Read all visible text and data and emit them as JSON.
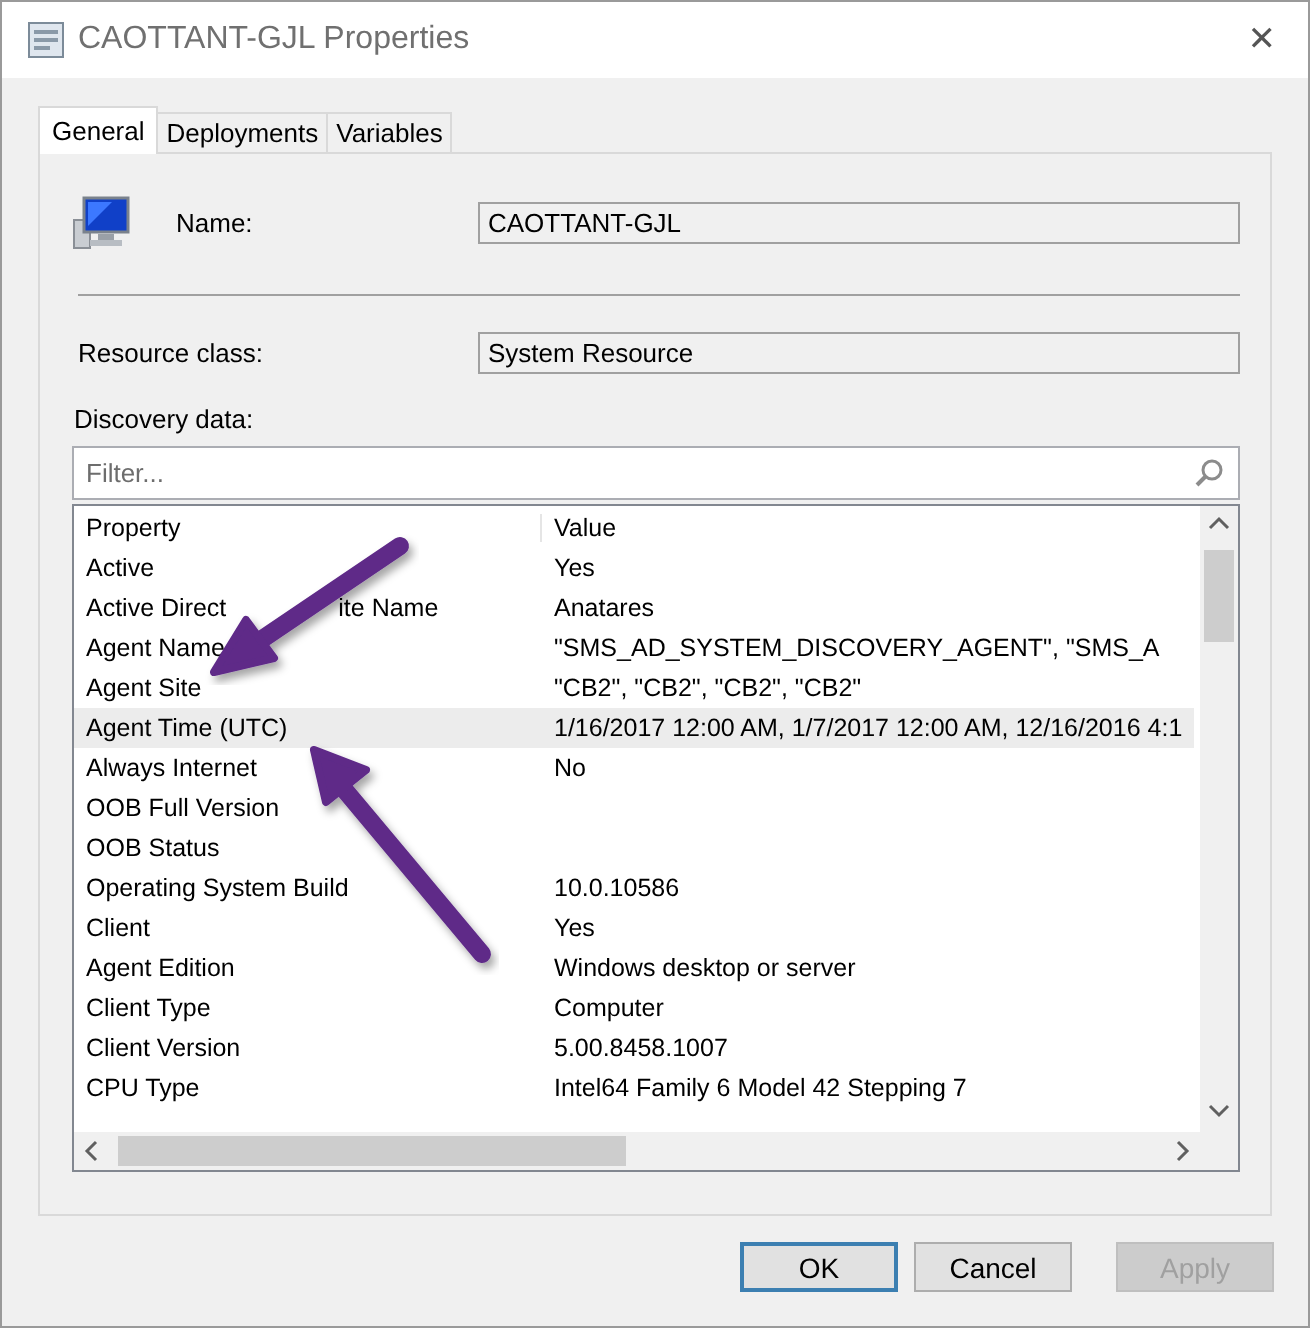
{
  "window": {
    "title": "CAOTTANT-GJL Properties",
    "close": "✕"
  },
  "tabs": [
    {
      "label": "General",
      "selected": true
    },
    {
      "label": "Deployments",
      "selected": false
    },
    {
      "label": "Variables",
      "selected": false
    }
  ],
  "general": {
    "name_label": "Name:",
    "name_value": "CAOTTANT-GJL",
    "class_label": "Resource class:",
    "class_value": "System Resource",
    "discovery_label": "Discovery data:"
  },
  "filter": {
    "placeholder": "Filter..."
  },
  "table": {
    "columns": [
      "Property",
      "Value"
    ],
    "rows": [
      {
        "property": "Active",
        "value": "Yes",
        "selected": false
      },
      {
        "property": "Active Direct",
        "property_tail": "ite Name",
        "value": "Anatares",
        "selected": false
      },
      {
        "property": "Agent Name",
        "value": "\"SMS_AD_SYSTEM_DISCOVERY_AGENT\", \"SMS_A",
        "selected": false
      },
      {
        "property": "Agent Site",
        "value": "\"CB2\", \"CB2\", \"CB2\", \"CB2\"",
        "selected": false
      },
      {
        "property": "Agent Time (UTC)",
        "value": "1/16/2017 12:00 AM, 1/7/2017 12:00 AM, 12/16/2016 4:1",
        "selected": true
      },
      {
        "property": "Always Internet",
        "value": "No",
        "selected": false
      },
      {
        "property": "OOB Full Version",
        "value": "",
        "selected": false
      },
      {
        "property": "OOB Status",
        "value": "",
        "selected": false
      },
      {
        "property": "Operating System Build",
        "value": "10.0.10586",
        "selected": false
      },
      {
        "property": "Client",
        "value": "Yes",
        "selected": false
      },
      {
        "property": "Agent Edition",
        "value": "Windows desktop or server",
        "selected": false
      },
      {
        "property": "Client Type",
        "value": "Computer",
        "selected": false
      },
      {
        "property": "Client Version",
        "value": "5.00.8458.1007",
        "selected": false
      },
      {
        "property": "CPU Type",
        "value": "Intel64 Family 6 Model 42 Stepping 7",
        "selected": false
      }
    ]
  },
  "buttons": [
    {
      "label": "OK",
      "disabled": false,
      "default": true
    },
    {
      "label": "Cancel",
      "disabled": false,
      "default": false
    },
    {
      "label": "Apply",
      "disabled": true,
      "default": false
    }
  ]
}
